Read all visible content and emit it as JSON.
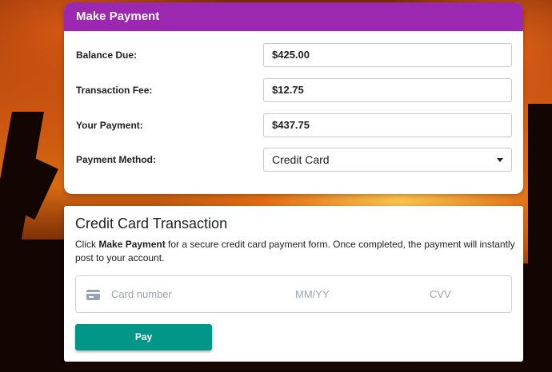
{
  "make_payment": {
    "title": "Make Payment",
    "balance_due": {
      "label": "Balance Due:",
      "value": "$425.00"
    },
    "transaction_fee": {
      "label": "Transaction Fee:",
      "value": "$12.75"
    },
    "your_payment": {
      "label": "Your Payment:",
      "value": "$437.75"
    },
    "payment_method": {
      "label": "Payment Method:",
      "selected": "Credit Card"
    }
  },
  "credit_card": {
    "title": "Credit Card Transaction",
    "desc_prefix": "Click ",
    "desc_bold": "Make Payment",
    "desc_suffix": " for a secure credit card payment form. Once completed, the payment will instantly post to your account.",
    "card_number_placeholder": "Card number",
    "expiry_placeholder": "MM/YY",
    "cvv_placeholder": "CVV",
    "pay_label": "Pay"
  },
  "colors": {
    "header": "#9c27b0",
    "pay_button": "#009688"
  }
}
